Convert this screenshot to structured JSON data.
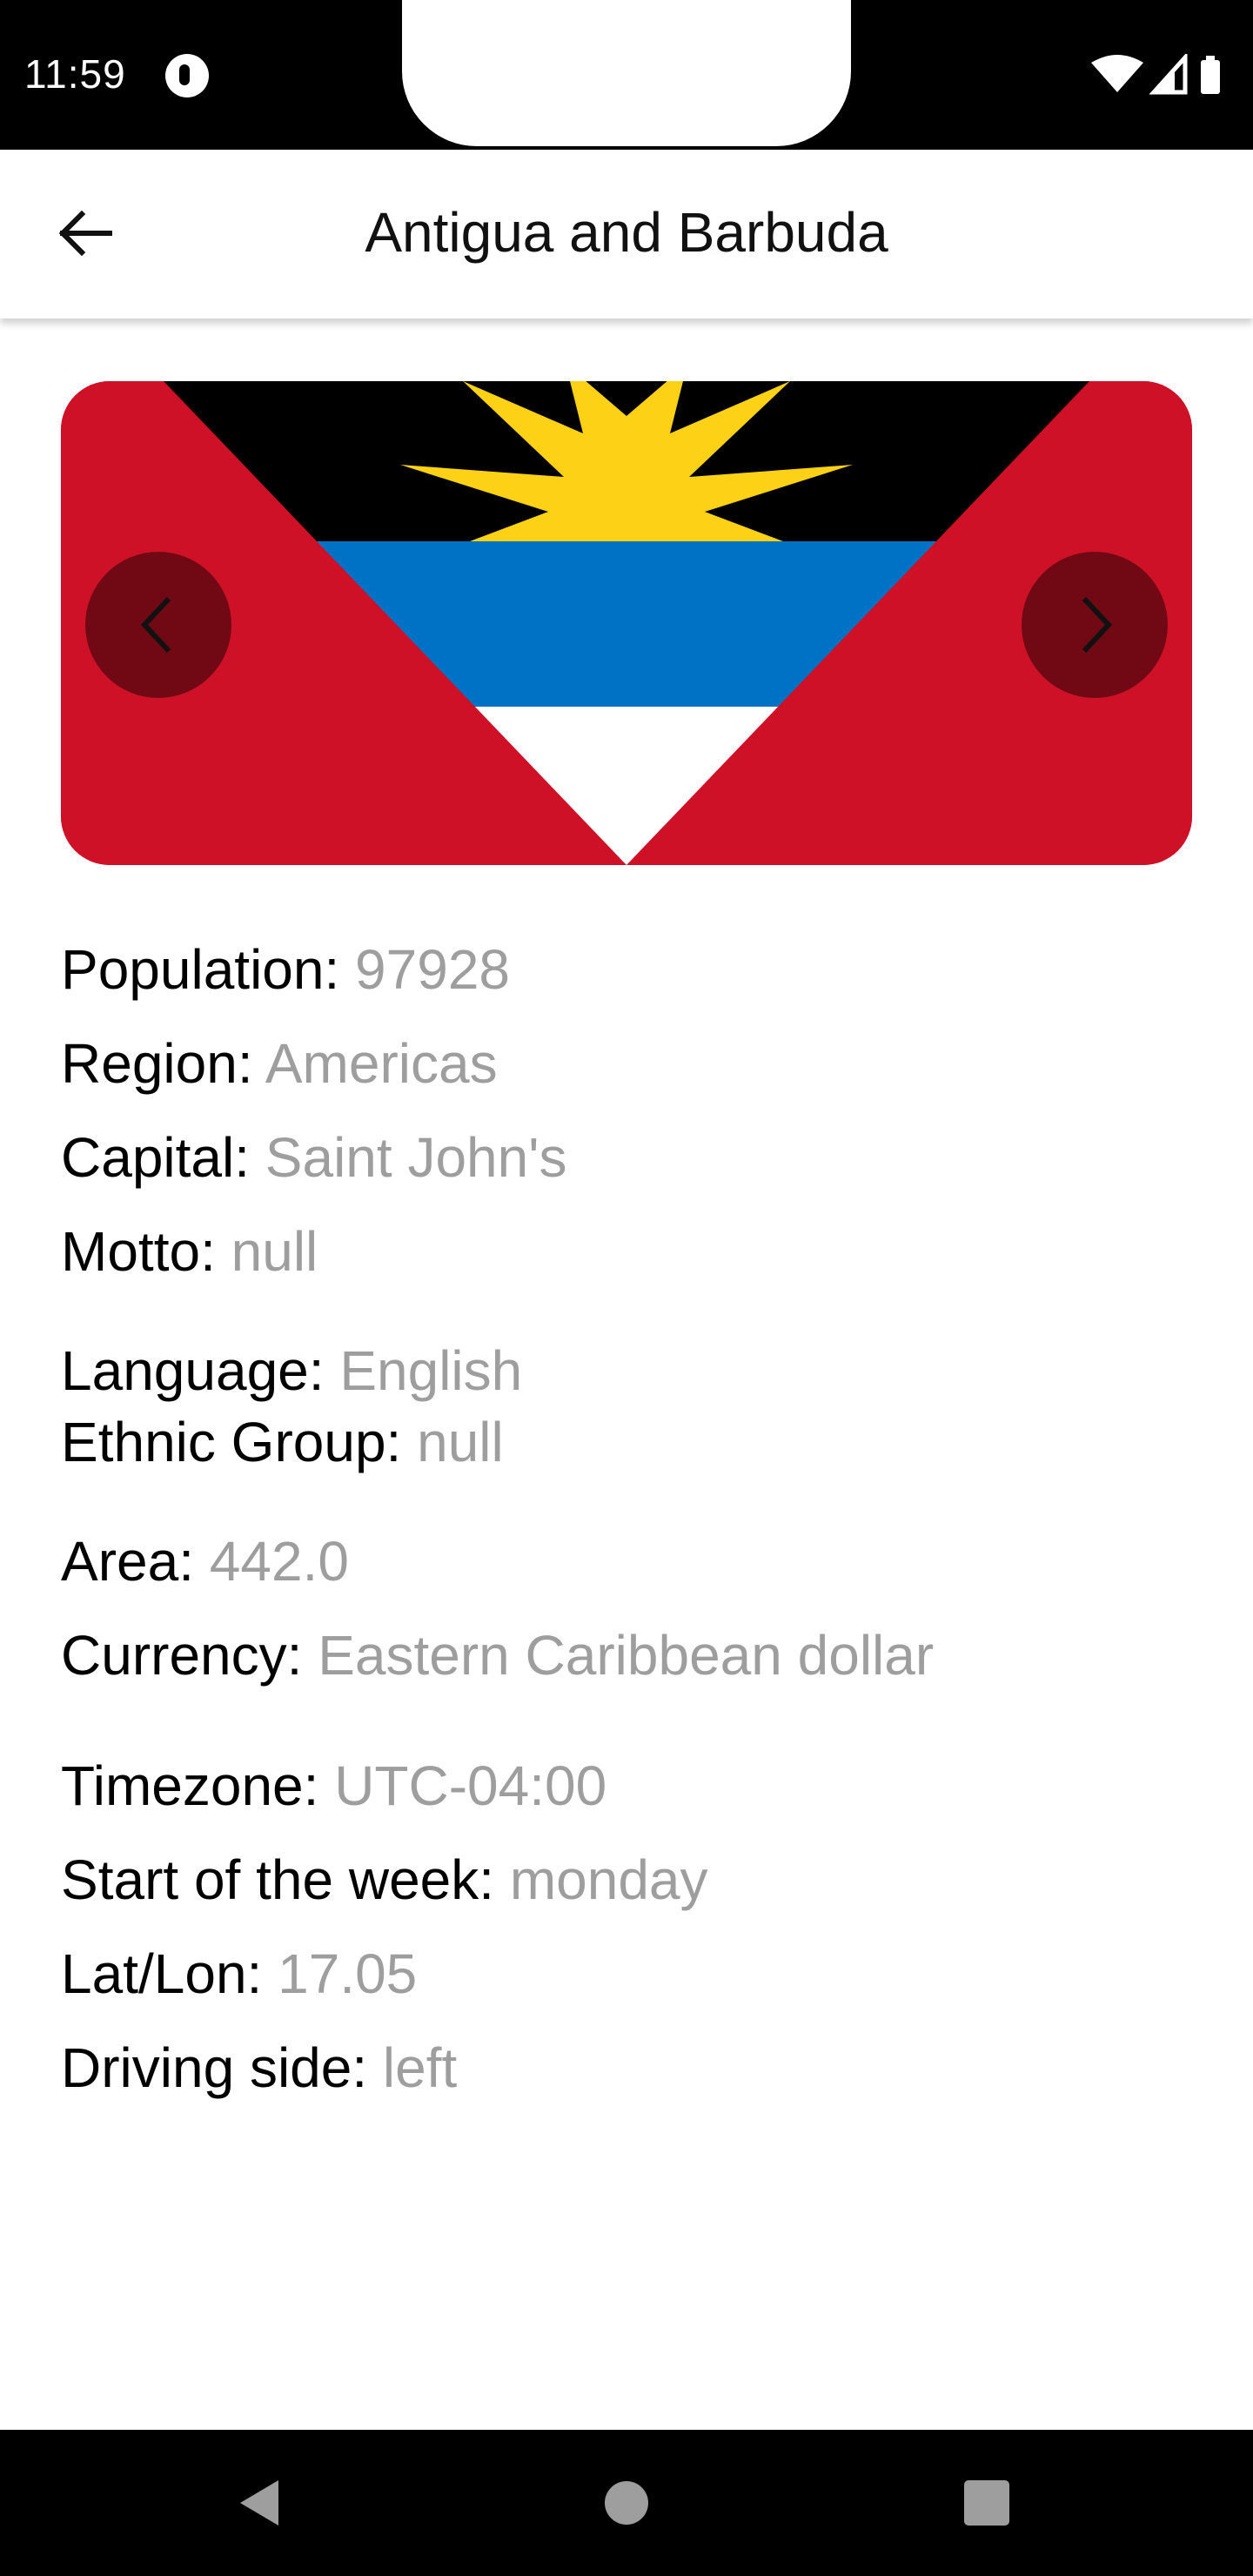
{
  "status_bar": {
    "time": "11:59",
    "icons": [
      "notification-badge-icon",
      "wifi-icon",
      "cellular-signal-icon",
      "battery-icon"
    ]
  },
  "app_bar": {
    "title": "Antigua and Barbuda",
    "back_icon": "arrow-left-icon"
  },
  "flag": {
    "country": "Antigua and Barbuda",
    "colors": {
      "red": "#ce1126",
      "black": "#000000",
      "blue": "#0072c6",
      "white": "#ffffff",
      "sun": "#fcd116"
    },
    "prev_icon": "chevron-left-icon",
    "next_icon": "chevron-right-icon"
  },
  "details": {
    "population": {
      "label": "Population:",
      "value": "97928"
    },
    "region": {
      "label": "Region:",
      "value": "Americas"
    },
    "capital": {
      "label": "Capital:",
      "value": "Saint John's"
    },
    "motto": {
      "label": "Motto:",
      "value": "null"
    },
    "language": {
      "label": "Language:",
      "value": "English"
    },
    "ethnic_group": {
      "label": "Ethnic Group:",
      "value": "null"
    },
    "area": {
      "label": "Area:",
      "value": "442.0"
    },
    "currency": {
      "label": "Currency:",
      "value": "Eastern Caribbean dollar"
    },
    "timezone": {
      "label": "Timezone:",
      "value": "UTC-04:00"
    },
    "start_of_week": {
      "label": "Start of the week:",
      "value": "monday"
    },
    "lat_lon": {
      "label": "Lat/Lon:",
      "value": "17.05"
    },
    "driving_side": {
      "label": "Driving side:",
      "value": "left"
    }
  },
  "nav_bar": {
    "icons": [
      "back-triangle-icon",
      "home-circle-icon",
      "recents-square-icon"
    ]
  },
  "theme": {
    "label_color": "#000000",
    "value_color": "#9e9e9e"
  }
}
